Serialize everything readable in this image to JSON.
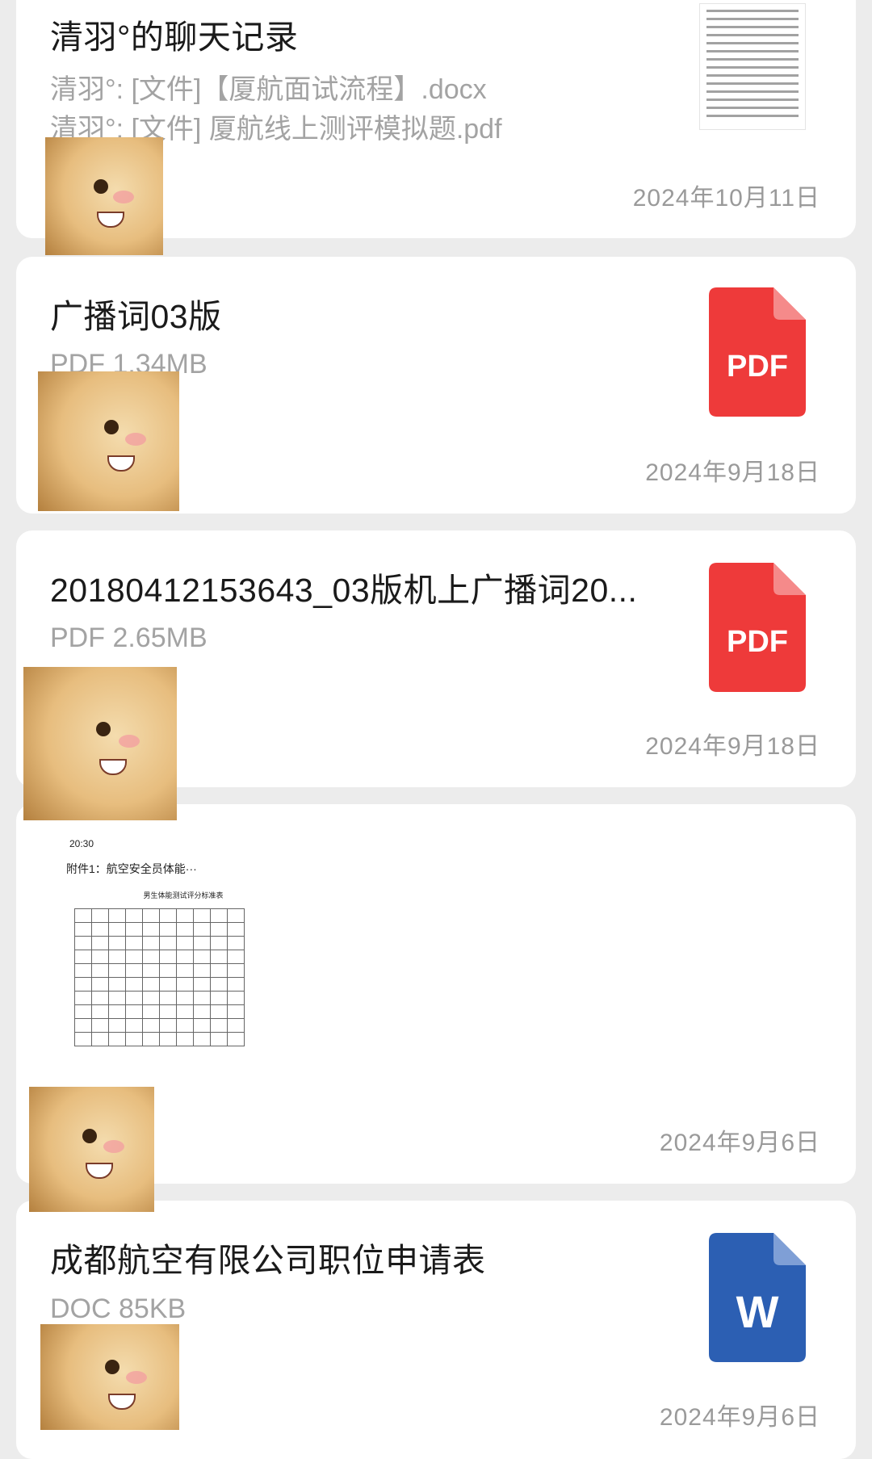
{
  "items": [
    {
      "title": "清羽°的聊天记录",
      "lines": [
        "清羽°: [文件]【厦航面试流程】.docx",
        "清羽°: [文件] 厦航线上测评模拟题.pdf"
      ],
      "date": "2024年10月11日",
      "icon": "doc-thumbnail-icon"
    },
    {
      "title": "广播词03版",
      "sub": "PDF 1.34MB",
      "date": "2024年9月18日",
      "icon": "pdf-file-icon",
      "icon_label": "PDF"
    },
    {
      "title": "20180412153643_03版机上广播词20...",
      "sub": "PDF 2.65MB",
      "date": "2024年9月18日",
      "icon": "pdf-file-icon",
      "icon_label": "PDF"
    },
    {
      "shot": {
        "status_time": "20:30",
        "nav_title": "附件1：航空安全员体能···",
        "table_title": "男生体能测试评分标准表"
      },
      "date": "2024年9月6日"
    },
    {
      "title": "成都航空有限公司职位申请表",
      "sub": "DOC 85KB",
      "date": "2024年9月6日",
      "icon": "word-file-icon",
      "icon_label": "W"
    }
  ],
  "colors": {
    "pdf": "#ee3a3a",
    "word": "#2c5fb3",
    "background": "#ececec"
  }
}
